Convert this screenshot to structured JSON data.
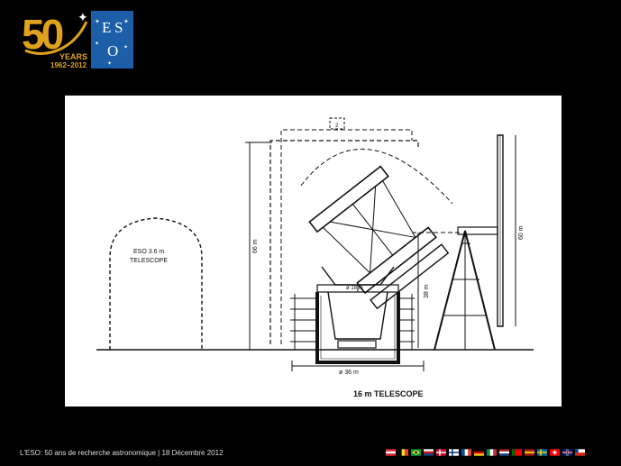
{
  "logo": {
    "anniversary_number": "50",
    "anniversary_word": "YEARS",
    "anniversary_years": "1962–2012",
    "org_letters": [
      "E",
      "S",
      "O"
    ],
    "gold_color": "#e0a21d",
    "blue_color": "#1c5ea8"
  },
  "diagram": {
    "left_dome_label_line1": "ESO 3.6 m",
    "left_dome_label_line2": "TELESCOPE",
    "height_66": "66 m",
    "height_38": "38 m",
    "height_60": "60 m",
    "dia_18": "ø 18 m",
    "dia_36": "ø 36 m",
    "small_dim": "2",
    "caption": "16 m TELESCOPE"
  },
  "footer": {
    "text": "L'ESO: 50 ans de recherche astronomique | 18 Décembre 2012",
    "flags": [
      {
        "name": "austria",
        "icon": "austria-flag-icon",
        "colors": [
          "#ed2939",
          "#ffffff",
          "#ed2939"
        ],
        "dir": "h"
      },
      {
        "name": "belgium",
        "icon": "belgium-flag-icon",
        "colors": [
          "#000000",
          "#fdda24",
          "#ef3340"
        ],
        "dir": "v"
      },
      {
        "name": "brazil",
        "icon": "brazil-flag-icon",
        "colors": [
          "#009c3b",
          "#ffdf00",
          "#002776"
        ],
        "dir": "c"
      },
      {
        "name": "czech",
        "icon": "czech-flag-icon",
        "colors": [
          "#ffffff",
          "#d7141a",
          "#11457e"
        ],
        "dir": "h"
      },
      {
        "name": "denmark",
        "icon": "denmark-flag-icon",
        "colors": [
          "#c60c30",
          "#ffffff"
        ],
        "dir": "x"
      },
      {
        "name": "finland",
        "icon": "finland-flag-icon",
        "colors": [
          "#ffffff",
          "#003580"
        ],
        "dir": "x"
      },
      {
        "name": "france",
        "icon": "france-flag-icon",
        "colors": [
          "#0055a4",
          "#ffffff",
          "#ef4135"
        ],
        "dir": "v"
      },
      {
        "name": "germany",
        "icon": "germany-flag-icon",
        "colors": [
          "#000000",
          "#dd0000",
          "#ffce00"
        ],
        "dir": "h"
      },
      {
        "name": "italy",
        "icon": "italy-flag-icon",
        "colors": [
          "#009246",
          "#ffffff",
          "#ce2b37"
        ],
        "dir": "v"
      },
      {
        "name": "netherlands",
        "icon": "netherlands-flag-icon",
        "colors": [
          "#ae1c28",
          "#ffffff",
          "#21468b"
        ],
        "dir": "h"
      },
      {
        "name": "portugal",
        "icon": "portugal-flag-icon",
        "colors": [
          "#006600",
          "#ff0000",
          "#ff0000"
        ],
        "dir": "v"
      },
      {
        "name": "spain",
        "icon": "spain-flag-icon",
        "colors": [
          "#aa151b",
          "#f1bf00",
          "#aa151b"
        ],
        "dir": "h"
      },
      {
        "name": "sweden",
        "icon": "sweden-flag-icon",
        "colors": [
          "#006aa7",
          "#fecc00"
        ],
        "dir": "x"
      },
      {
        "name": "switzerland",
        "icon": "switzerland-flag-icon",
        "colors": [
          "#ff0000",
          "#ffffff"
        ],
        "dir": "s"
      },
      {
        "name": "uk",
        "icon": "uk-flag-icon",
        "colors": [
          "#012169",
          "#ffffff",
          "#c8102e"
        ],
        "dir": "u"
      },
      {
        "name": "chile",
        "icon": "chile-flag-icon",
        "colors": [
          "#ffffff",
          "#d52b1e",
          "#0039a6"
        ],
        "dir": "cl"
      }
    ]
  }
}
